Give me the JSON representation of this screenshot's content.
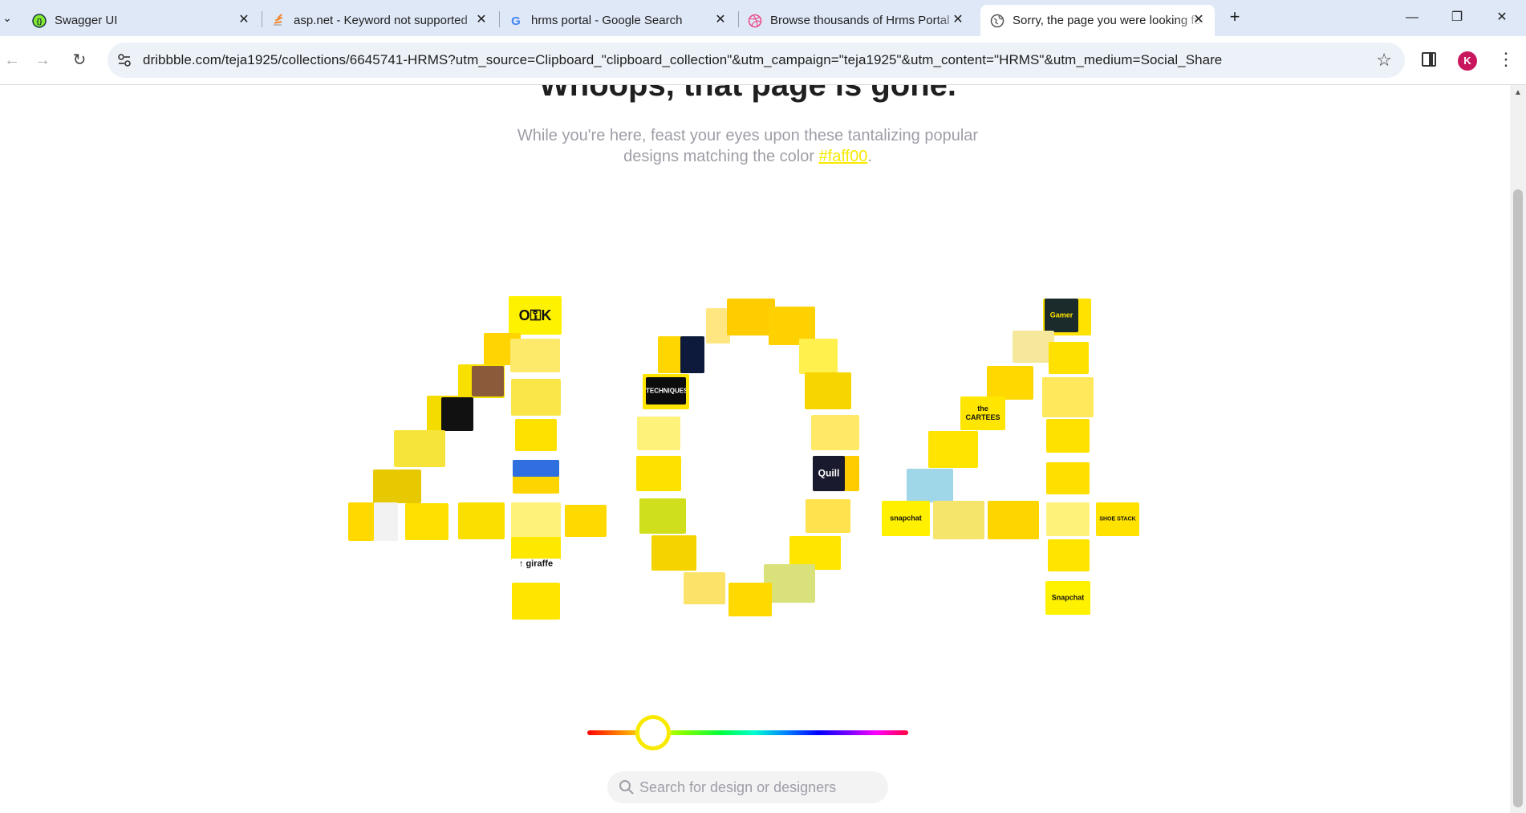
{
  "browser": {
    "tabs": [
      {
        "title": "Swagger UI",
        "icon": "swagger-icon"
      },
      {
        "title": "asp.net - Keyword not supported",
        "icon": "stackoverflow-icon"
      },
      {
        "title": "hrms portal - Google Search",
        "icon": "google-icon"
      },
      {
        "title": "Browse thousands of Hrms Portal",
        "icon": "dribbble-icon"
      },
      {
        "title": "Sorry, the page you were looking for",
        "icon": "globe-icon",
        "active": true
      }
    ],
    "url": "dribbble.com/teja1925/collections/6645741-HRMS?utm_source=Clipboard_\"clipboard_collection\"&utm_campaign=\"teja1925\"&utm_content=\"HRMS\"&utm_medium=Social_Share",
    "profile_initial": "K",
    "profile_color": "#c8175d"
  },
  "page": {
    "headline": "Whoops, that page is gone.",
    "subtext_before": "While you're here, feast your eyes upon these tantalizing popular designs matching the color ",
    "color_link": "#faff00",
    "subtext_after": ".",
    "accent_color": "#f7ea00",
    "search_placeholder": "Search for design or designers"
  },
  "thumbnails": {
    "labels": {
      "ok": "O⚿K",
      "techniques": "TECHNIQUES",
      "cartees": "the CARTEES",
      "quill": "Quill",
      "giraffe": "↑ giraffe",
      "snapchat": "snapchat",
      "snapchat2": "Snapchat",
      "gamer": "Gamer",
      "shoe_stack": "SHOE STACK"
    }
  }
}
